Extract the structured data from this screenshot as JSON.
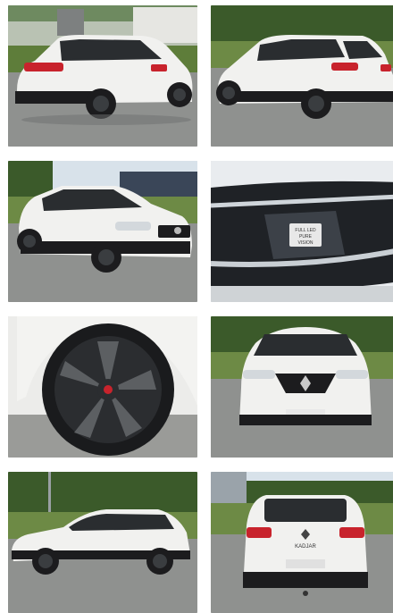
{
  "gallery": {
    "photos": [
      {
        "subject": "rear-left three-quarter view",
        "icon": "car-photo"
      },
      {
        "subject": "rear-right three-quarter view",
        "icon": "car-photo"
      },
      {
        "subject": "front-left three-quarter view",
        "icon": "car-photo"
      },
      {
        "subject": "headlight close-up",
        "icon": "headlight-photo",
        "label": "FULL LED PURE VISION"
      },
      {
        "subject": "alloy wheel close-up",
        "icon": "wheel-photo"
      },
      {
        "subject": "front view",
        "icon": "car-photo"
      },
      {
        "subject": "side profile",
        "icon": "car-photo"
      },
      {
        "subject": "rear view",
        "icon": "car-photo",
        "label": "KADJAR"
      }
    ]
  },
  "colors": {
    "body": "#f1f1ef",
    "trim": "#1c1c1e",
    "taillight": "#c8232c",
    "asphalt": "#8f918f",
    "grass": "#5e7d3a",
    "trees": "#3b5a2a",
    "sky": "#d8e2ea"
  }
}
